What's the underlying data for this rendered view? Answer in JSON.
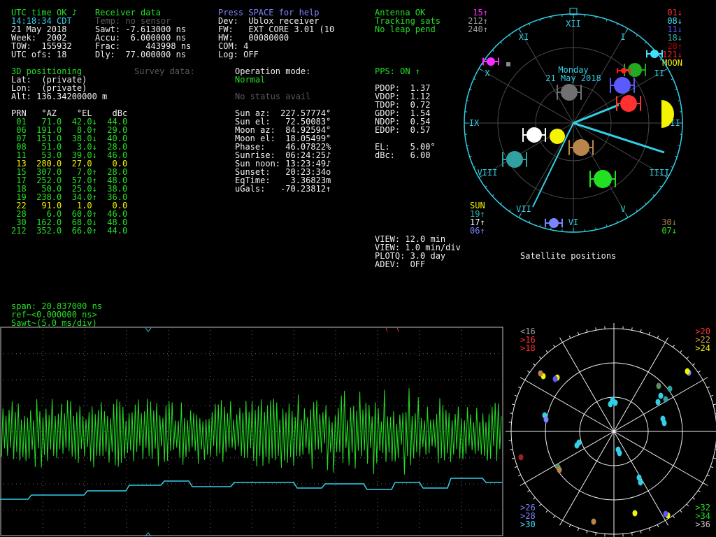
{
  "top_left": {
    "utc_status": "UTC time OK ♪",
    "time": "14:18:34 CDT",
    "date": "21 May 2018",
    "week": "Week:  2002",
    "tow": "TOW:  155932",
    "utc_ofs": "UTC ofs: 18"
  },
  "receiver": {
    "title": "Receiver data",
    "temp": "Temp: no sensor",
    "sawt": "Sawt: -7.613000 ns",
    "accu": "Accu:  6.000000 ns",
    "frac": "Frac:     443998 ns",
    "dly": "Dly:  77.000000 ns"
  },
  "device": {
    "help": "Press SPACE for help",
    "dev": "Dev:  Ublox receiver",
    "fw": "FW:   EXT CORE 3.01 (10",
    "hw": "HW:   00080000",
    "com": "COM: 4",
    "log": "Log: OFF"
  },
  "antenna": {
    "status": "Antenna OK",
    "tracking": "Tracking sats",
    "leap": "No leap pend"
  },
  "positioning": {
    "title": "3D positioning",
    "survey": "Survey data:",
    "lat": "Lat:  (private)",
    "lon": "Lon:  (private)",
    "alt": "Alt: 136.34200000 m"
  },
  "operation": {
    "title": "Operation mode:",
    "mode": "Normal",
    "status": "No status avail"
  },
  "pps": {
    "title": "PPS: ON ↑",
    "pdop": "PDOP:  1.37",
    "vdop": "VDOP:  1.12",
    "tdop": "TDOP:  0.72",
    "gdop": "GDOP:  1.54",
    "ndop": "NDOP:  0.54",
    "edop": "EDOP:  0.57",
    "el": "EL:    5.00°",
    "dbc": "dBc:   6.00"
  },
  "sat_table": {
    "header": "PRN   °AZ    °EL    dBc",
    "rows": [
      {
        "text": " 01   71.0  42.0↓  44.0",
        "color": "#22e022"
      },
      {
        "text": " 06  191.0   8.0↑  29.0",
        "color": "#22e022"
      },
      {
        "text": " 07  151.0  38.0↓  40.0",
        "color": "#22e022"
      },
      {
        "text": " 08   51.0   3.0↓  28.0",
        "color": "#22e022"
      },
      {
        "text": " 11   53.0  39.0↓  46.0",
        "color": "#22e022"
      },
      {
        "text": " 13  280.0  27.0    0.0",
        "color": "#f4f400"
      },
      {
        "text": " 15  307.0   7.0↑  28.0",
        "color": "#22e022"
      },
      {
        "text": " 17  252.0  57.0↑  48.0",
        "color": "#22e022"
      },
      {
        "text": " 18   50.0  25.0↓  38.0",
        "color": "#22e022"
      },
      {
        "text": " 19  238.0  34.0↑  36.0",
        "color": "#22e022"
      },
      {
        "text": " 22   91.0   1.0    0.0",
        "color": "#f4f400"
      },
      {
        "text": " 28    6.0  60.0↑  46.0",
        "color": "#22e022"
      },
      {
        "text": " 30  162.0  68.0↓  48.0",
        "color": "#22e022"
      },
      {
        "text": "212  352.0  66.0↑  44.0",
        "color": "#22e022"
      }
    ]
  },
  "astro": {
    "sun_az": "Sun az:  227.57774°",
    "sun_el": "Sun el:   72.50083°",
    "moon_az": "Moon az:  84.92594°",
    "moon_el": "Moon el:  18.05499°",
    "phase": "Phase:    46.07822%",
    "sunrise": "Sunrise:  06:24:25♪",
    "sun_noon": "Sun noon: 13:23:49♪",
    "sunset": "Sunset:   20:23:34o",
    "eqtime": "EqTime:    3.36823m",
    "ugals": "uGals:   -70.23812↑"
  },
  "view": {
    "view1": "VIEW: 12.0 min",
    "view2": "VIEW: 1.0 min/div",
    "plotq": "PLOTQ: 3.0 day",
    "adev": "ADEV:  OFF",
    "sat_positions": "Satellite positions"
  },
  "plot_labels": {
    "span": "span: 20.837000 ns",
    "ref": "ref~<0.000000 ns>",
    "sawt": "Sawt~(5.0 ms/div)"
  },
  "clock": {
    "day": "Monday",
    "date": "21 May 2018",
    "numerals": [
      "XII",
      "I",
      "II",
      "III",
      "IIII",
      "V",
      "VI",
      "VII",
      "VIII",
      "IX",
      "X",
      "XI"
    ]
  },
  "sat_legend_left": [
    {
      "text": "15↑",
      "color": "#ff2cff"
    },
    {
      "text": "212↑",
      "color": "#a0a0a0"
    },
    {
      "text": "240↑",
      "color": "#a0a0a0"
    }
  ],
  "sat_legend_right": [
    {
      "text": "01↓",
      "color": "#ff3030"
    },
    {
      "text": "08↓",
      "color": "#40e0ff"
    },
    {
      "text": "11↓",
      "color": "#5a5aff"
    },
    {
      "text": "18↓",
      "color": "#30b0b0"
    },
    {
      "text": "28↑",
      "color": "#c00000"
    },
    {
      "text": "121↓",
      "color": "#ff2020"
    },
    {
      "text": "MOON",
      "color": "#f4f400"
    }
  ],
  "sat_legend_bottom_left": [
    {
      "text": "SUN",
      "color": "#f4f400"
    },
    {
      "text": "19↑",
      "color": "#30b0b0"
    },
    {
      "text": "17↑",
      "color": "#ffffff"
    },
    {
      "text": "06↑",
      "color": "#7c84ff"
    }
  ],
  "sat_legend_bottom_right": [
    {
      "text": "30↓",
      "color": "#b8864b"
    },
    {
      "text": "07↓",
      "color": "#22e022"
    }
  ],
  "sky_labels_left_top": [
    {
      "text": "<16",
      "color": "#a0a0a0"
    },
    {
      "text": ">16",
      "color": "#ff3030"
    },
    {
      "text": ">18",
      "color": "#ff3030"
    }
  ],
  "sky_labels_right_top": [
    {
      "text": ">20",
      "color": "#ff3030"
    },
    {
      "text": ">22",
      "color": "#d2a050"
    },
    {
      "text": ">24",
      "color": "#f4f400"
    }
  ],
  "sky_labels_left_bottom": [
    {
      "text": ">26",
      "color": "#7c84ff"
    },
    {
      "text": ">28",
      "color": "#7c84ff"
    },
    {
      "text": ">30",
      "color": "#40e0ff"
    }
  ],
  "sky_labels_right_bottom": [
    {
      "text": ">32",
      "color": "#22e022"
    },
    {
      "text": ">34",
      "color": "#22e022"
    },
    {
      "text": ">36",
      "color": "#c0c0c0"
    }
  ]
}
